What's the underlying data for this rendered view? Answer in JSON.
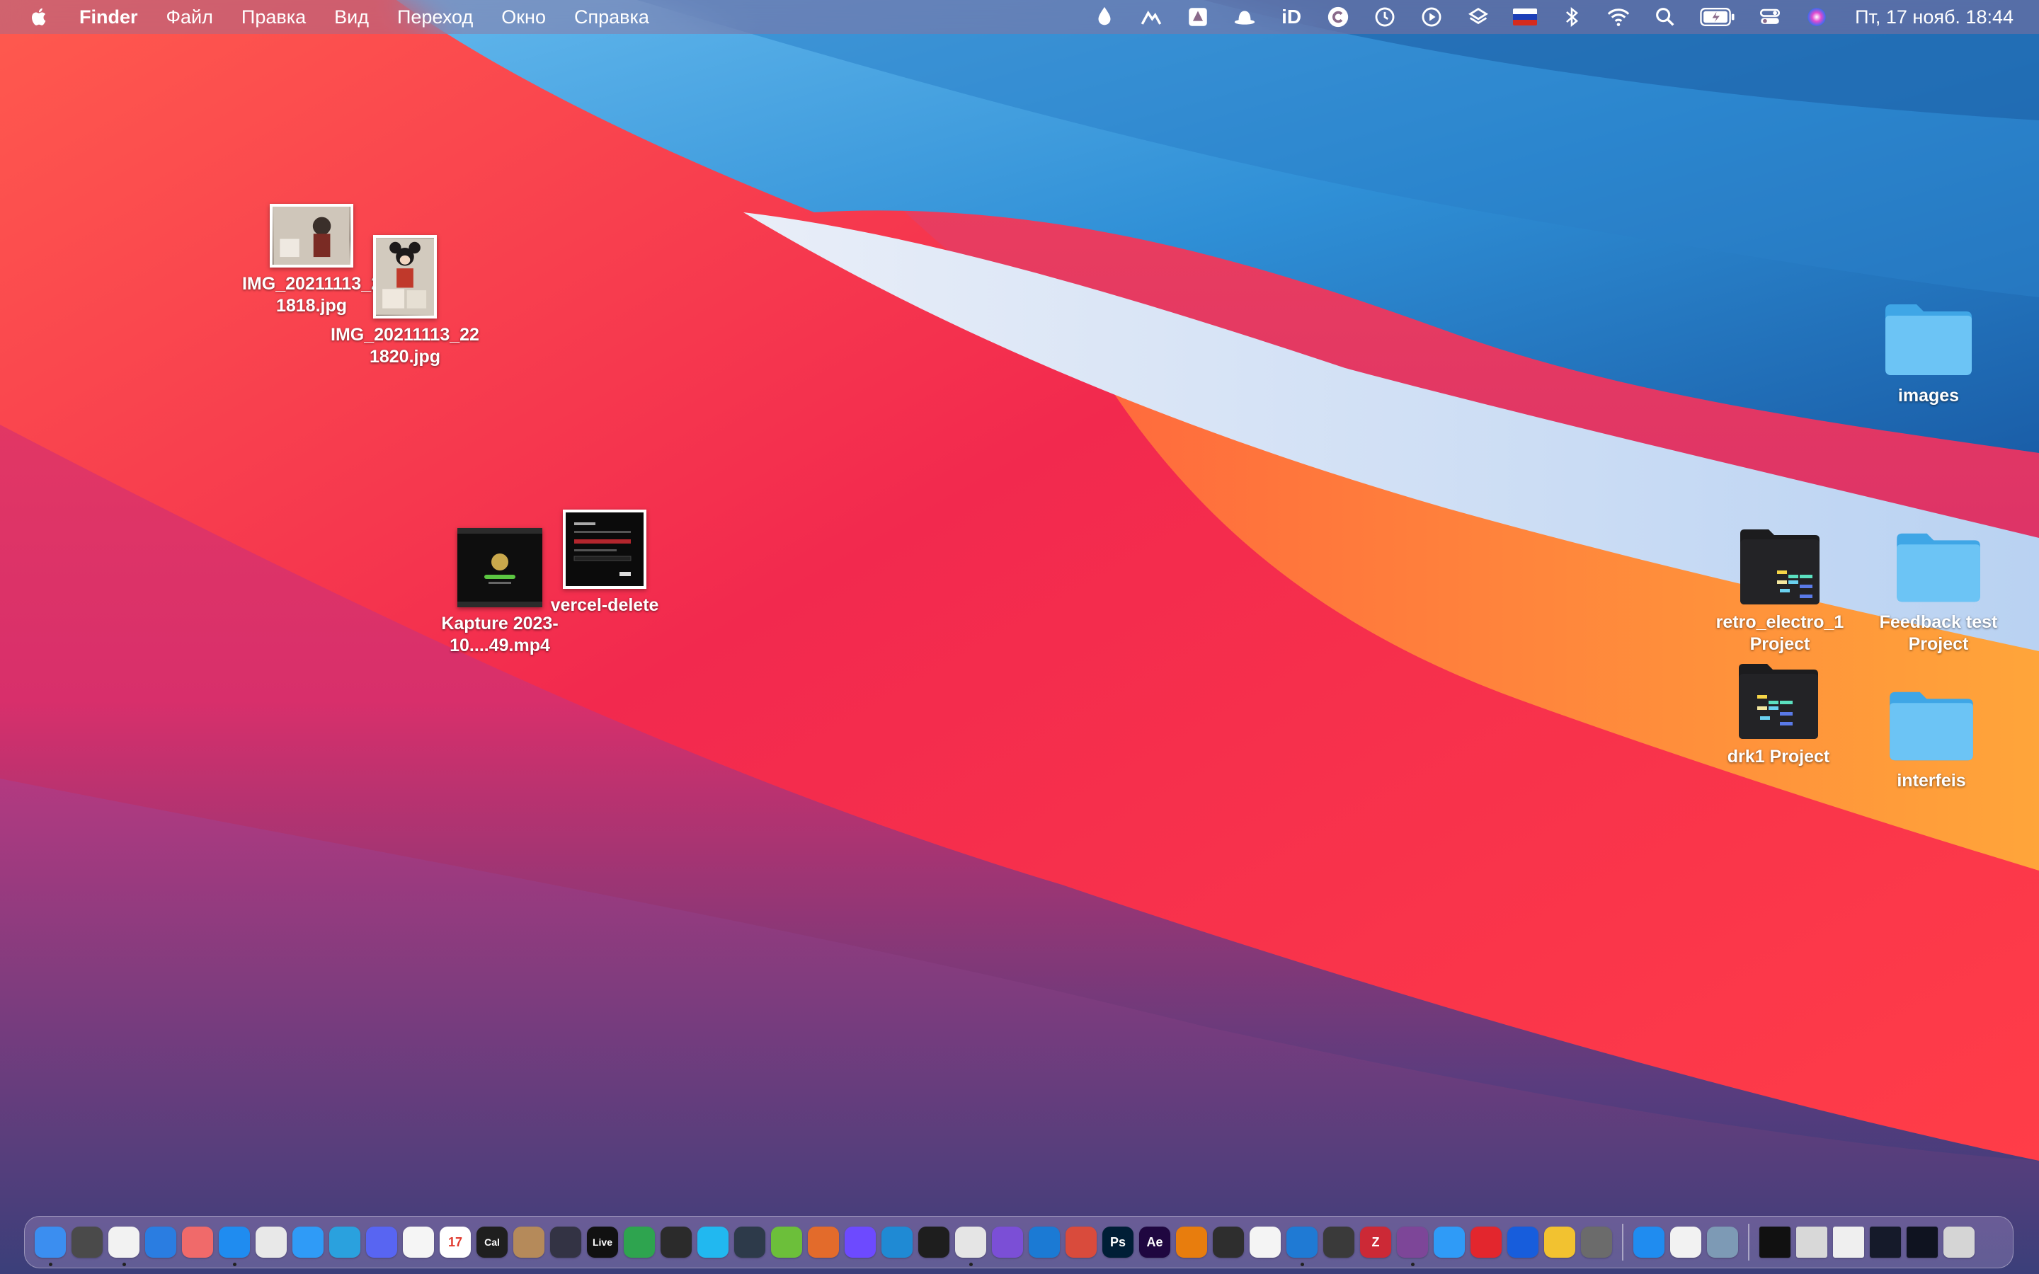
{
  "menubar": {
    "app_name": "Finder",
    "menus": [
      "Файл",
      "Правка",
      "Вид",
      "Переход",
      "Окно",
      "Справка"
    ],
    "status_icons": [
      "drop-icon",
      "mountain-icon",
      "drive-icon",
      "hat-icon",
      "id-icon",
      "c-icon",
      "time-machine-icon",
      "play-circle-icon",
      "layers-icon",
      "flag-ru-icon",
      "bluetooth-icon",
      "wifi-icon",
      "spotlight-icon",
      "battery-icon",
      "control-center-icon",
      "siri-icon"
    ],
    "id_text": "iD",
    "clock": "Пт, 17 нояб.  18:44"
  },
  "desktop": {
    "icons": [
      {
        "label": "IMG_20211113_2 1818.jpg",
        "kind": "photo"
      },
      {
        "label": "IMG_20211113_22 1820.jpg",
        "kind": "photo"
      },
      {
        "label": "Kapture 2023-10....49.mp4",
        "kind": "video"
      },
      {
        "label": "vercel-delete",
        "kind": "screenshot"
      },
      {
        "label": "images",
        "kind": "folder"
      },
      {
        "label": "retro_electro_1 Project",
        "kind": "project"
      },
      {
        "label": "Feedback test Project",
        "kind": "folder"
      },
      {
        "label": "drk1 Project",
        "kind": "project"
      },
      {
        "label": "interfeis",
        "kind": "folder"
      }
    ]
  },
  "dock": {
    "apps": [
      {
        "name": "finder-icon",
        "color": "#3b8ef0",
        "text": "",
        "running": true
      },
      {
        "name": "calculator-icon",
        "color": "#4a4a4a",
        "text": "",
        "running": false
      },
      {
        "name": "clock-icon",
        "color": "#f2f2f2",
        "text": "",
        "running": true
      },
      {
        "name": "xcode-tools-icon",
        "color": "#2a7de1",
        "text": "",
        "running": false
      },
      {
        "name": "asana-icon",
        "color": "#f06a6a",
        "text": "",
        "running": false
      },
      {
        "name": "safari-icon",
        "color": "#1f8cf0",
        "text": "",
        "running": true
      },
      {
        "name": "chrome-icon",
        "color": "#e8e8e8",
        "text": "",
        "running": false
      },
      {
        "name": "mail-icon",
        "color": "#2f9bf7",
        "text": "",
        "running": false
      },
      {
        "name": "telegram-icon",
        "color": "#2aa1de",
        "text": "",
        "running": false
      },
      {
        "name": "discord-icon",
        "color": "#5865f2",
        "text": "",
        "running": false
      },
      {
        "name": "photos-icon",
        "color": "#f5f5f5",
        "text": "",
        "running": false
      },
      {
        "name": "calendar-icon",
        "color": "#ffffff",
        "text": "17",
        "running": false
      },
      {
        "name": "cal-com-icon",
        "color": "#1f1f1f",
        "text": "Cal",
        "running": false
      },
      {
        "name": "contacts-icon",
        "color": "#b58a5a",
        "text": "",
        "running": false
      },
      {
        "name": "infuse-icon",
        "color": "#333344",
        "text": "",
        "running": false
      },
      {
        "name": "ableton-live-icon",
        "color": "#111111",
        "text": "Live",
        "running": false
      },
      {
        "name": "vectornator-icon",
        "color": "#2ea44f",
        "text": "",
        "running": false
      },
      {
        "name": "arc-icon",
        "color": "#2b2b2b",
        "text": "",
        "running": false
      },
      {
        "name": "network-radar-icon",
        "color": "#21b8f0",
        "text": "",
        "running": false
      },
      {
        "name": "davinci-icon",
        "color": "#2d3a4a",
        "text": "",
        "running": false
      },
      {
        "name": "pineapple-icon",
        "color": "#6cbf3a",
        "text": "",
        "running": false
      },
      {
        "name": "scene-icon",
        "color": "#e36b2b",
        "text": "",
        "running": false
      },
      {
        "name": "proton-vpn-icon",
        "color": "#6d4aff",
        "text": "",
        "running": false
      },
      {
        "name": "edge-icon",
        "color": "#1f8ad4",
        "text": "",
        "running": false
      },
      {
        "name": "figma-icon",
        "color": "#1e1e1e",
        "text": "",
        "running": false
      },
      {
        "name": "pixelmator-icon",
        "color": "#e5e5e5",
        "text": "",
        "running": true
      },
      {
        "name": "affinity-photo-icon",
        "color": "#7b4fd6",
        "text": "",
        "running": false
      },
      {
        "name": "affinity-designer-icon",
        "color": "#1b7ad4",
        "text": "",
        "running": false
      },
      {
        "name": "affinity-publisher-icon",
        "color": "#d94b3c",
        "text": "",
        "running": false
      },
      {
        "name": "photoshop-icon",
        "color": "#001e36",
        "text": "Ps",
        "running": false
      },
      {
        "name": "after-effects-icon",
        "color": "#1f0740",
        "text": "Ae",
        "running": false
      },
      {
        "name": "blender-icon",
        "color": "#e87d0d",
        "text": "",
        "running": false
      },
      {
        "name": "obs-icon",
        "color": "#2e2e2e",
        "text": "",
        "running": false
      },
      {
        "name": "white-circle-icon",
        "color": "#f4f4f4",
        "text": "",
        "running": false
      },
      {
        "name": "vscode-icon",
        "color": "#1f7ad4",
        "text": "",
        "running": true
      },
      {
        "name": "sublime-icon",
        "color": "#3a3a3a",
        "text": "",
        "running": false
      },
      {
        "name": "zotero-icon",
        "color": "#cc2936",
        "text": "Z",
        "running": false
      },
      {
        "name": "tor-icon",
        "color": "#7d4698",
        "text": "",
        "running": true
      },
      {
        "name": "testflight-icon",
        "color": "#2f9bf7",
        "text": "",
        "running": false
      },
      {
        "name": "adobe-cc-icon",
        "color": "#e3262d",
        "text": "",
        "running": false
      },
      {
        "name": "bitwarden-icon",
        "color": "#175ddc",
        "text": "",
        "running": false
      },
      {
        "name": "cyberduck-icon",
        "color": "#f2c230",
        "text": "",
        "running": false
      },
      {
        "name": "system-preferences-icon",
        "color": "#6b6b6b",
        "text": "",
        "running": false
      }
    ],
    "extras": [
      {
        "name": "app-store-icon",
        "color": "#1f8cf0",
        "text": ""
      },
      {
        "name": "font-book-icon",
        "color": "#f2f2f2",
        "text": ""
      },
      {
        "name": "migration-icon",
        "color": "#7d9ab5",
        "text": ""
      }
    ],
    "minimized": [
      {
        "name": "minimized-window-terminal",
        "color": "#111111"
      },
      {
        "name": "minimized-window-photo",
        "color": "#d8d8d8"
      },
      {
        "name": "minimized-window-screenshot",
        "color": "#efefef"
      },
      {
        "name": "minimized-window-dark-1",
        "color": "#151a2a"
      },
      {
        "name": "minimized-window-dark-2",
        "color": "#0f1320"
      },
      {
        "name": "trash-icon",
        "color": "#d5d5d5"
      }
    ]
  }
}
